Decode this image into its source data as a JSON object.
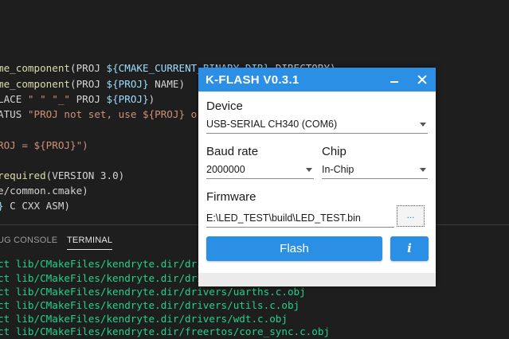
{
  "editor": {
    "lines": [
      [
        {
          "t": "me_component",
          "c": "fn"
        },
        {
          "t": "(PROJ ",
          "c": "txt"
        },
        {
          "t": "${CMAKE_CURRENT_BINARY_DIR}",
          "c": "var"
        },
        {
          "t": " DIRECTORY)",
          "c": "txt"
        }
      ],
      [
        {
          "t": "me_component",
          "c": "fn"
        },
        {
          "t": "(PROJ ",
          "c": "txt"
        },
        {
          "t": "${PROJ}",
          "c": "var"
        },
        {
          "t": " NAME)",
          "c": "txt"
        }
      ],
      [
        {
          "t": "LACE ",
          "c": "txt"
        },
        {
          "t": "\" \" \"_\"",
          "c": "str"
        },
        {
          "t": " PROJ ",
          "c": "txt"
        },
        {
          "t": "${PROJ}",
          "c": "var"
        },
        {
          "t": ")",
          "c": "txt"
        }
      ],
      [
        {
          "t": "ATUS ",
          "c": "txt"
        },
        {
          "t": "\"PROJ not set, use ${PROJ} or use default e.g. -DPROJ",
          "c": "str"
        }
      ],
      [],
      [
        {
          "t": "ROJ = ${PROJ}\")",
          "c": "str"
        }
      ],
      [],
      [
        {
          "t": "required",
          "c": "fn"
        },
        {
          "t": "(VERSION 3.0)",
          "c": "txt"
        }
      ],
      [
        {
          "t": "e/common.cmake)",
          "c": "txt"
        }
      ],
      [
        {
          "t": "}",
          "c": "var"
        },
        {
          "t": " C CXX ASM)",
          "c": "txt"
        }
      ]
    ]
  },
  "panel": {
    "tabs": [
      "UG CONSOLE",
      "TERMINAL"
    ],
    "terminal_lines": [
      "ct lib/CMakeFiles/kendryte.dir/drivers/",
      "ct lib/CMakeFiles/kendryte.dir/drivers/",
      "ct lib/CMakeFiles/kendryte.dir/drivers/uarths.c.obj",
      "ct lib/CMakeFiles/kendryte.dir/drivers/utils.c.obj",
      "ct lib/CMakeFiles/kendryte.dir/drivers/wdt.c.obj",
      "ct lib/CMakeFiles/kendryte.dir/freertos/core_sync.c.obj"
    ]
  },
  "dialog": {
    "title": "K-FLASH V0.3.1",
    "device_label": "Device",
    "device_value": "USB-SERIAL CH340 (COM6)",
    "baud_label": "Baud rate",
    "baud_value": "2000000",
    "chip_label": "Chip",
    "chip_value": "In-Chip",
    "firmware_label": "Firmware",
    "firmware_value": "E:\\LED_TEST\\build\\LED_TEST.bin",
    "browse_label": "...",
    "flash_label": "Flash",
    "info_label": "i"
  },
  "colors": {
    "accent": "#2c8fe6",
    "terminal_text": "#23d18b"
  }
}
